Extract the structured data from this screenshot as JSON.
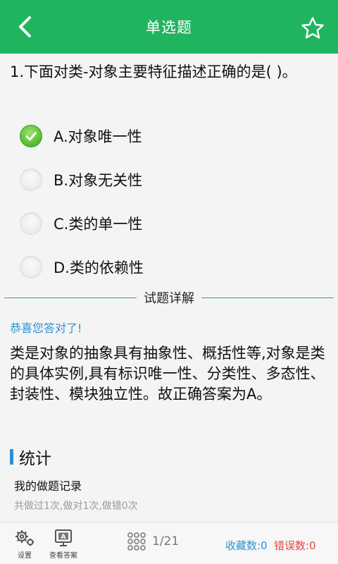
{
  "header": {
    "title": "单选题",
    "back_icon": "chevron-left-icon",
    "favorite_icon": "star-outline-icon",
    "color": "#21b45f"
  },
  "question": {
    "text": "1.下面对类-对象主要特征描述正确的是( )。"
  },
  "options": [
    {
      "label": "A.对象唯一性",
      "selected": true
    },
    {
      "label": "B.对象无关性",
      "selected": false
    },
    {
      "label": "C.类的单一性",
      "selected": false
    },
    {
      "label": "D.类的依赖性",
      "selected": false
    }
  ],
  "explanation": {
    "section_label": "试题详解",
    "result_text": "恭喜您答对了!",
    "body": "类是对象的抽象具有抽象性、概括性等,对象是类的具体实例,具有标识唯一性、分类性、多态性、封装性、模块独立性。故正确答案为A。"
  },
  "stats": {
    "title": "统计",
    "record_title": "我的做题记录",
    "record_summary": "共做过1次,做对1次,做错0次"
  },
  "bottom_bar": {
    "settings_label": "设置",
    "settings_icon": "gear-icon",
    "answer_label": "查看答案",
    "answer_icon": "answer-monitor-icon",
    "grid_icon": "grid-icon",
    "page_indicator": "1/21",
    "favorites_count": "收藏数:0",
    "errors_count": "错误数:0"
  },
  "colors": {
    "accent_blue": "#2b93d0",
    "error_red": "#e04b3c",
    "selected_green": "#5fc43a"
  }
}
